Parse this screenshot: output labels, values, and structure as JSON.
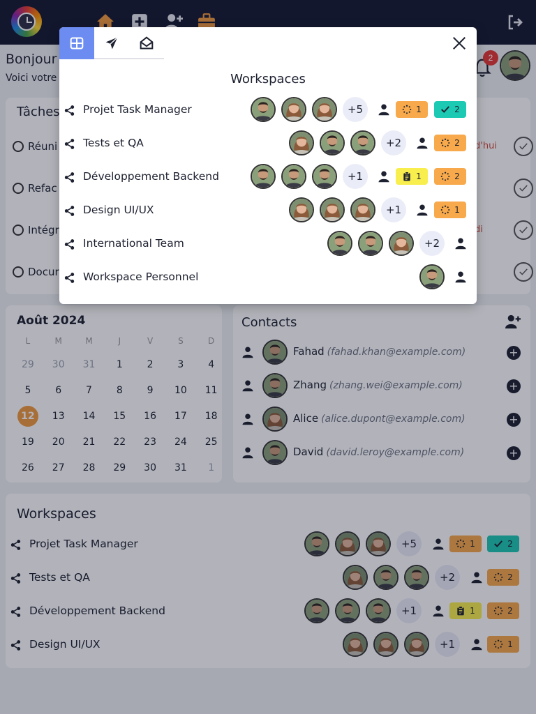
{
  "header": {
    "greeting": "Bonjour",
    "subtitle": "Voici votre",
    "notification_count": "2"
  },
  "tasks": {
    "title": "Tâches",
    "items": [
      {
        "label": "Réuni",
        "date": "d'hui"
      },
      {
        "label": "Refac",
        "date": ""
      },
      {
        "label": "Intégr",
        "date": "di"
      },
      {
        "label": "Docur",
        "date": ""
      }
    ]
  },
  "calendar": {
    "title": "Août 2024",
    "weekdays": [
      "L",
      "M",
      "M",
      "J",
      "V",
      "S",
      "D"
    ],
    "weeks": [
      [
        "29",
        "30",
        "31",
        "1",
        "2",
        "3",
        "4"
      ],
      [
        "5",
        "6",
        "7",
        "8",
        "9",
        "10",
        "11"
      ],
      [
        "12",
        "13",
        "14",
        "15",
        "16",
        "17",
        "18"
      ],
      [
        "19",
        "20",
        "21",
        "22",
        "23",
        "24",
        "25"
      ],
      [
        "26",
        "27",
        "28",
        "29",
        "30",
        "31",
        "1"
      ]
    ],
    "today": "12"
  },
  "contacts": {
    "title": "Contacts",
    "items": [
      {
        "name": "Fahad",
        "email": "(fahad.khan@example.com)"
      },
      {
        "name": "Zhang",
        "email": "(zhang.wei@example.com)"
      },
      {
        "name": "Alice",
        "email": "(alice.dupont@example.com)"
      },
      {
        "name": "David",
        "email": "(david.leroy@example.com)"
      }
    ]
  },
  "workspaces_card": {
    "title": "Workspaces",
    "items": [
      {
        "name": "Projet Task Manager",
        "more": "+5",
        "pending": "1",
        "done": "2"
      },
      {
        "name": "Tests et QA",
        "more": "+2",
        "pending": "2"
      },
      {
        "name": "Développement Backend",
        "more": "+1",
        "todo": "1",
        "pending": "2"
      },
      {
        "name": "Design UI/UX",
        "more": "+1",
        "pending": "1"
      }
    ]
  },
  "modal": {
    "title": "Workspaces",
    "tabs": [
      "grid",
      "sent",
      "inbox"
    ],
    "items": [
      {
        "name": "Projet Task Manager",
        "more": "+5",
        "pending": "1",
        "done": "2"
      },
      {
        "name": "Tests et QA",
        "more": "+2",
        "pending": "2"
      },
      {
        "name": "Développement Backend",
        "more": "+1",
        "todo": "1",
        "pending": "2"
      },
      {
        "name": "Design UI/UX",
        "more": "+1",
        "pending": "1"
      },
      {
        "name": "International Team",
        "more": "+2"
      },
      {
        "name": "Workspace Personnel"
      }
    ]
  },
  "colors": {
    "nav": "#161a31",
    "accent": "#6c8cf2",
    "pending": "#f7a94b",
    "todo": "#f8ee4d",
    "done": "#1cc9b3",
    "today": "#f19a3e",
    "notification": "#e53935"
  },
  "icons": [
    "logo-icon",
    "home-icon",
    "add-square-icon",
    "add-user-icon",
    "briefcase-icon",
    "logout-icon",
    "bell-icon",
    "share-icon",
    "person-icon",
    "pending-icon",
    "check-icon",
    "clipboard-icon",
    "grid-icon",
    "send-icon",
    "inbox-icon",
    "close-icon",
    "add-circle-icon"
  ]
}
